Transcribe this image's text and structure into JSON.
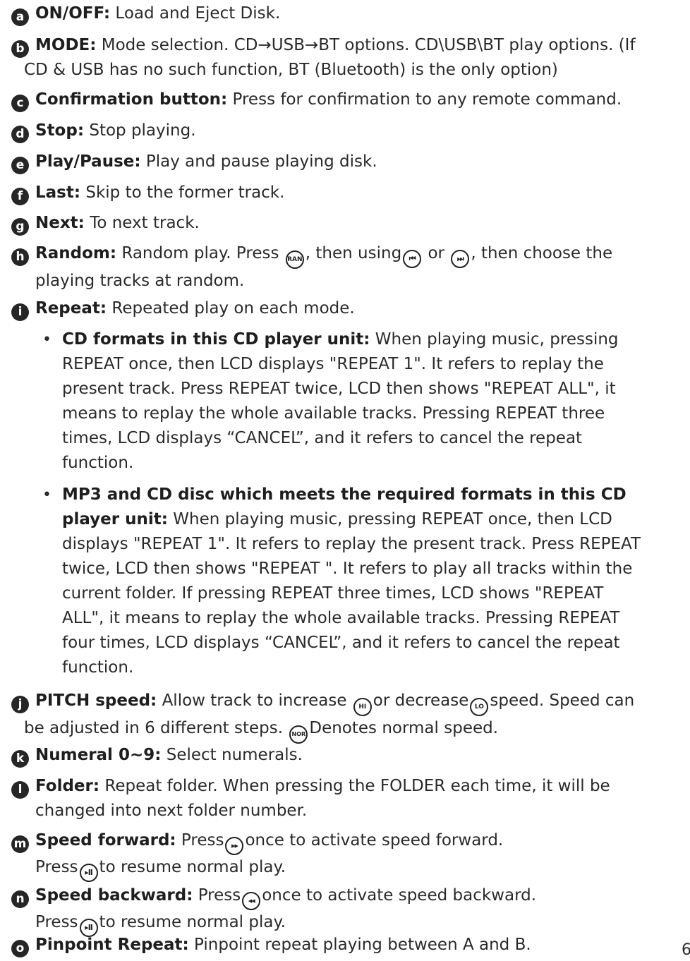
{
  "items": [
    {
      "letter": "a",
      "label": "ON/OFF:",
      "text": " Load and Eject Disk."
    },
    {
      "letter": "b",
      "label": "MODE:",
      "text": " Mode selection. CD→USB→BT options. CD\\USB\\BT play options. (If",
      "cont": "CD & USB has no such function, BT (Bluetooth) is the only option)"
    },
    {
      "letter": "c",
      "label": "Confirmation button:",
      "text": " Press for confirmation to any remote command."
    },
    {
      "letter": "d",
      "label": "Stop:",
      "text": " Stop playing."
    },
    {
      "letter": "e",
      "label": "Play/Pause:",
      "text": " Play and pause playing disk."
    },
    {
      "letter": "f",
      "label": "Last:",
      "text": " Skip to the former track."
    },
    {
      "letter": "g",
      "label": "Next:",
      "text": " To next track."
    },
    {
      "letter": "h",
      "label": "Random:",
      "t1": " Random play. Press ",
      "t2": ", then using",
      "t3": " or ",
      "t4": ", then choose the",
      "cont": "playing tracks at random."
    },
    {
      "letter": "i",
      "label": "Repeat:",
      "text": " Repeated play on each mode."
    },
    {
      "letter": "j",
      "label": "PITCH speed:",
      "t1": " Allow track to increase ",
      "t2": "or decrease",
      "t3": "speed. Speed can",
      "c1": "be adjusted in 6 different steps. ",
      "c2": "Denotes normal speed."
    },
    {
      "letter": "k",
      "label": "Numeral 0~9:",
      "text": " Select numerals."
    },
    {
      "letter": "l",
      "label": "Folder:",
      "text": " Repeat folder. When pressing the FOLDER each time, it will be",
      "cont": "changed into next folder number."
    },
    {
      "letter": "m",
      "label": "Speed forward:",
      "t1": " Press",
      "t2": "once to activate speed forward.",
      "c1": "Press",
      "c2": "to resume normal play."
    },
    {
      "letter": "n",
      "label": "Speed backward:",
      "t1": " Press",
      "t2": "once to activate speed backward.",
      "c1": "Press",
      "c2": "to resume normal play."
    },
    {
      "letter": "o",
      "label": "Pinpoint Repeat:",
      "text": " Pinpoint repeat playing between A and B."
    }
  ],
  "bullets": [
    {
      "label": "CD formats in this CD player unit:",
      "lines": [
        " When playing music, pressing",
        "REPEAT once, then LCD displays \"REPEAT 1\". It refers to replay the",
        "present track. Press REPEAT twice, LCD then shows \"REPEAT ALL\", it",
        "means to replay the whole available tracks. Pressing REPEAT three",
        "times, LCD displays “CANCEL”, and it refers to cancel the repeat",
        "function."
      ]
    },
    {
      "label1": "MP3 and CD disc which meets the required formats in this CD",
      "label2": "player unit:",
      "lines": [
        " When playing music, pressing REPEAT once, then LCD",
        "displays \"REPEAT 1\". It refers to replay the present track. Press REPEAT",
        "twice, LCD then shows \"REPEAT \". It refers to play all tracks within the",
        "current folder. If pressing REPEAT three times, LCD shows \"REPEAT",
        "ALL\", it means to replay the whole available tracks. Pressing REPEAT",
        "four times, LCD displays “CANCEL”, and it refers to cancel the repeat",
        "function."
      ]
    }
  ],
  "icons": {
    "ran": "RAN",
    "prev": "⏮",
    "next": "⏭",
    "hi": "HI",
    "lo": "LO",
    "nor": "NOR",
    "ff": "▸▸",
    "playpause": "▸II",
    "rew": "◂◂"
  },
  "page_number": "6"
}
